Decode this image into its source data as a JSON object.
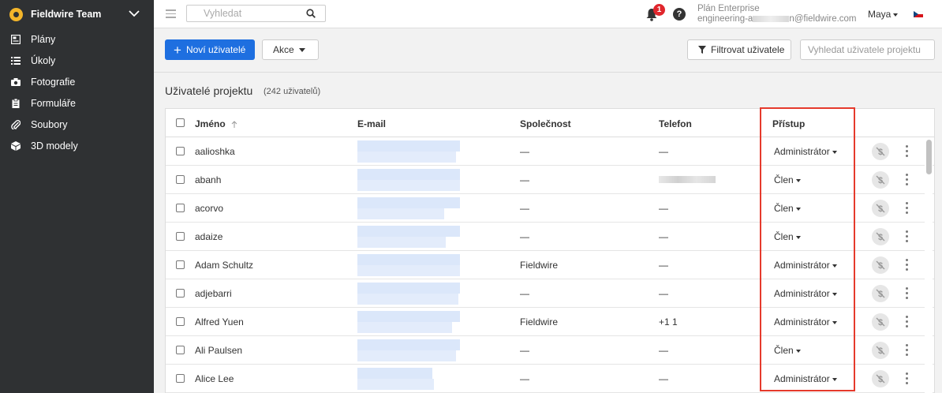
{
  "sidebar": {
    "team_name": "Fieldwire Team",
    "items": [
      {
        "label": "Plány",
        "icon": "plans-icon"
      },
      {
        "label": "Úkoly",
        "icon": "tasks-list-icon"
      },
      {
        "label": "Fotografie",
        "icon": "camera-icon"
      },
      {
        "label": "Formuláře",
        "icon": "clipboard-icon"
      },
      {
        "label": "Soubory",
        "icon": "paperclip-icon"
      },
      {
        "label": "3D modely",
        "icon": "cube-icon"
      }
    ]
  },
  "topbar": {
    "search_placeholder": "Vyhledat",
    "notification_count": "1",
    "help_label": "?",
    "plan_name": "Plán Enterprise",
    "email_prefix": "engineering-a",
    "email_suffix": "n@fieldwire.com",
    "user_name": "Maya"
  },
  "toolbar": {
    "new_users_label": "Noví uživatelé",
    "actions_label": "Akce",
    "filter_label": "Filtrovat uživatele",
    "search_placeholder": "Vyhledat uživatele projektu"
  },
  "page": {
    "title": "Uživatelé projektu",
    "count": "(242 uživatelů)"
  },
  "table": {
    "columns": {
      "name": "Jméno",
      "email": "E-mail",
      "company": "Společnost",
      "phone": "Telefon",
      "access": "Přístup"
    },
    "rows": [
      {
        "name": "aalioshka",
        "company": "—",
        "phone": "—",
        "access": "Administrátor"
      },
      {
        "name": "abanh",
        "company": "—",
        "phone": "",
        "access": "Člen"
      },
      {
        "name": "acorvo",
        "company": "—",
        "phone": "—",
        "access": "Člen"
      },
      {
        "name": "adaize",
        "company": "—",
        "phone": "—",
        "access": "Člen"
      },
      {
        "name": "Adam Schultz",
        "company": "Fieldwire",
        "phone": "—",
        "access": "Administrátor"
      },
      {
        "name": "adjebarri",
        "company": "—",
        "phone": "—",
        "access": "Administrátor"
      },
      {
        "name": "Alfred Yuen",
        "company": "Fieldwire",
        "phone": "+1 1",
        "access": "Administrátor"
      },
      {
        "name": "Ali Paulsen",
        "company": "—",
        "phone": "—",
        "access": "Člen"
      },
      {
        "name": "Alice Lee",
        "company": "—",
        "phone": "—",
        "access": "Administrátor"
      }
    ]
  }
}
